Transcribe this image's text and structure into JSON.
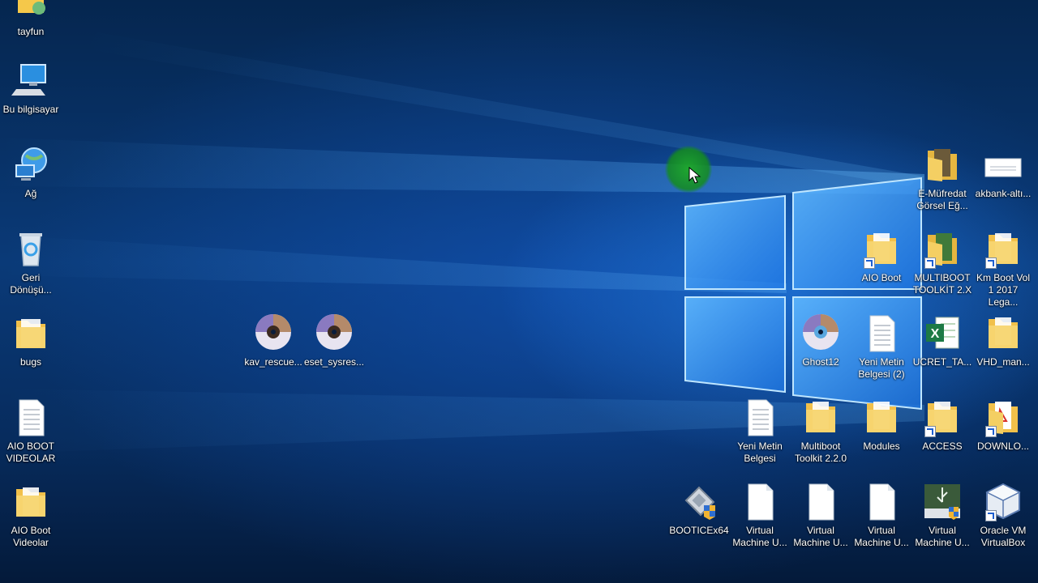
{
  "desktop": {
    "icons": [
      {
        "label": "tayfun",
        "icon": "user-folder-icon"
      },
      {
        "label": "Bu bilgisayar",
        "icon": "this-pc-icon"
      },
      {
        "label": "Ağ",
        "icon": "network-icon"
      },
      {
        "label": "Geri Dönüşü...",
        "icon": "recycle-bin-icon"
      },
      {
        "label": "bugs",
        "icon": "folder-icon"
      },
      {
        "label": "AIO BOOT VIDEOLAR",
        "icon": "text-file-icon"
      },
      {
        "label": "AIO Boot Videolar",
        "icon": "folder-icon"
      },
      {
        "label": "kav_rescue...",
        "icon": "disc-image-icon"
      },
      {
        "label": "eset_sysres...",
        "icon": "disc-image-icon"
      },
      {
        "label": "E-Müfredat Görsel Eğ...",
        "icon": "folder-icon"
      },
      {
        "label": "akbank-altı...",
        "icon": "image-file-icon"
      },
      {
        "label": "AIO Boot",
        "icon": "folder-shortcut-icon"
      },
      {
        "label": "MULTIBOOT TOOLKİT 2.X",
        "icon": "folder-shortcut-icon"
      },
      {
        "label": "Km Boot Vol 1 2017 Lega...",
        "icon": "folder-shortcut-icon"
      },
      {
        "label": "Ghost12",
        "icon": "disc-image-icon"
      },
      {
        "label": "Yeni Metin Belgesi (2)",
        "icon": "text-file-icon"
      },
      {
        "label": "UCRET_TA...",
        "icon": "excel-file-icon"
      },
      {
        "label": "VHD_man...",
        "icon": "folder-icon"
      },
      {
        "label": "Yeni Metin Belgesi",
        "icon": "text-file-icon"
      },
      {
        "label": "Multiboot Toolkit 2.2.0",
        "icon": "folder-icon"
      },
      {
        "label": "Modules",
        "icon": "folder-icon"
      },
      {
        "label": "ACCESS",
        "icon": "folder-shortcut-icon"
      },
      {
        "label": "DOWNLO...",
        "icon": "pdf-shortcut-icon"
      },
      {
        "label": "BOOTICEx64",
        "icon": "bootice-app-icon"
      },
      {
        "label": "Virtual Machine U...",
        "icon": "blank-file-icon"
      },
      {
        "label": "Virtual Machine U...",
        "icon": "blank-file-icon"
      },
      {
        "label": "Virtual Machine U...",
        "icon": "blank-file-icon"
      },
      {
        "label": "Virtual Machine U...",
        "icon": "usb-app-icon"
      },
      {
        "label": "Oracle VM VirtualBox",
        "icon": "virtualbox-shortcut-icon"
      }
    ]
  },
  "colors": {
    "wallpaper_dark": "#06204a",
    "wallpaper_glow": "#3a9bff",
    "cursor_highlight": "#1faa2a",
    "icon_label": "#ffffff"
  }
}
